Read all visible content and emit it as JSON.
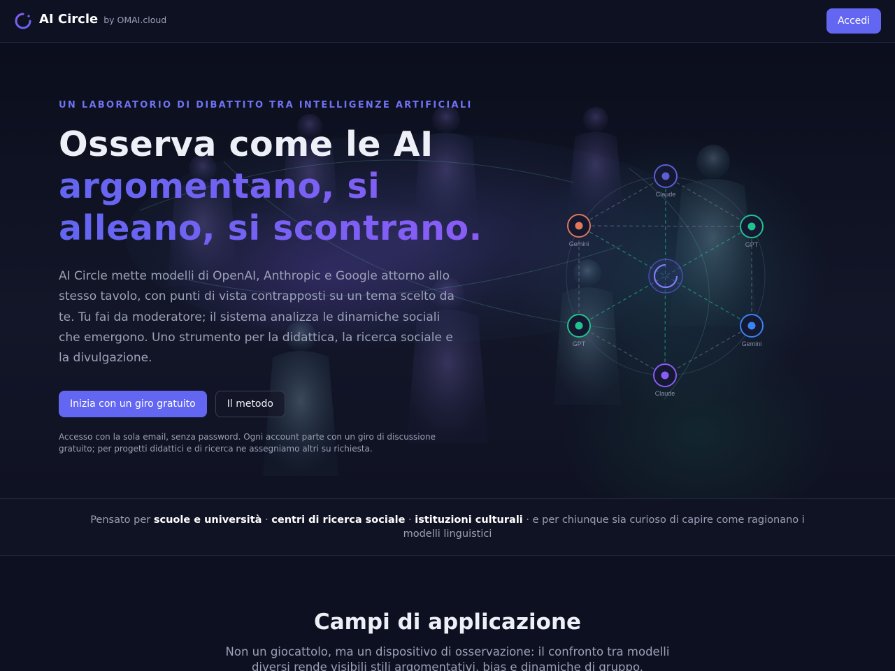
{
  "nav": {
    "brand": "AI Circle",
    "brand_by": "by OMAI.cloud",
    "login_label": "Accedi"
  },
  "hero": {
    "eyebrow": "UN LABORATORIO DI DIBATTITO TRA INTELLIGENZE ARTIFICIALI",
    "headline_line1": "Osserva come le AI",
    "headline_line2": "argomentano, si",
    "headline_line3": "alleano, si scontrano.",
    "lead": "AI Circle mette modelli di OpenAI, Anthropic e Google attorno allo stesso tavolo, con punti di vista contrapposti su un tema scelto da te. Tu fai da moderatore; il sistema analizza le dinamiche sociali che emergono. Uno strumento per la didattica, la ricerca sociale e la divulgazione.",
    "cta_primary": "Inizia con un giro gratuito",
    "cta_secondary": "Il metodo",
    "note": "Accesso con la sola email, senza password. Ogni account parte con un giro di discussione gratuito; per progetti didattici e di ricerca ne assegniamo altri su richiesta."
  },
  "diagram": {
    "nodes": [
      {
        "label": "Claude",
        "color": "#5b5fd6"
      },
      {
        "label": "GPT",
        "color": "#22c28f"
      },
      {
        "label": "Gemini",
        "color": "#3b82f6"
      },
      {
        "label": "Claude",
        "color": "#8b5cf6"
      },
      {
        "label": "GPT",
        "color": "#22c28f"
      },
      {
        "label": "Gemini",
        "color": "#e0785a"
      }
    ]
  },
  "audience": {
    "prefix": "Pensato per ",
    "item1": "scuole e università",
    "sep1": " · ",
    "item2": "centri di ricerca sociale",
    "sep2": " · ",
    "item3": "istituzioni culturali",
    "suffix": " · e per chiunque sia curioso di capire come ragionano i modelli linguistici"
  },
  "section": {
    "title": "Campi di applicazione",
    "subtitle": "Non un giocattolo, ma un dispositivo di osservazione: il confronto tra modelli diversi rende visibili stili argomentativi, bias e dinamiche di gruppo."
  },
  "colors": {
    "accent": "#6366f1",
    "accent_violet": "#8b5cf6",
    "background": "#0d1020"
  }
}
